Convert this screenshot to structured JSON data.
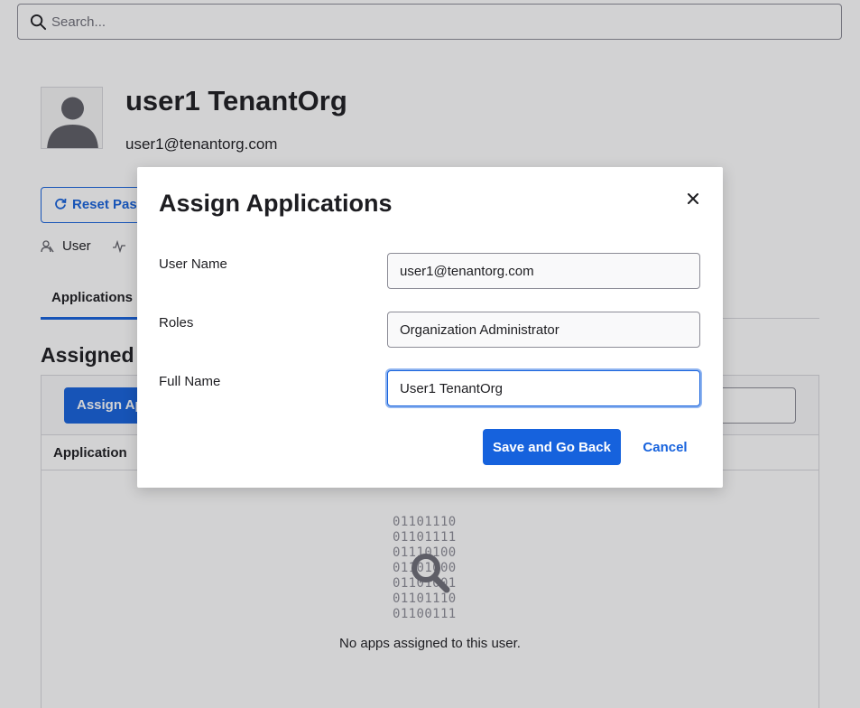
{
  "search": {
    "placeholder": "Search..."
  },
  "profile": {
    "name": "user1 TenantOrg",
    "email": "user1@tenantorg.com",
    "reset_label": "Reset Password",
    "role_label": "User"
  },
  "tabs": [
    {
      "label": "Applications"
    }
  ],
  "section": {
    "title": "Assigned Applications",
    "assign_label": "Assign Applications",
    "column_application": "Application",
    "binary_lines": [
      "01101110",
      "01101111",
      "01110100",
      "01101000",
      "01101001",
      "01101110",
      "01100111"
    ],
    "empty_message": "No apps assigned to this user."
  },
  "modal": {
    "title": "Assign Applications",
    "fields": [
      {
        "label": "User Name",
        "value": "user1@tenantorg.com"
      },
      {
        "label": "Roles",
        "value": "Organization Administrator"
      },
      {
        "label": "Full Name",
        "value": "User1 TenantOrg"
      }
    ],
    "save_label": "Save and Go Back",
    "cancel_label": "Cancel"
  },
  "colors": {
    "accent": "#1662dd",
    "text": "#1d1d21",
    "border": "#8c8c96",
    "focus_ring": "#8fb4f0"
  },
  "icons": {
    "search": "search-icon",
    "close": "close-icon",
    "reset": "refresh-icon",
    "user": "user-icon",
    "activity": "activity-icon",
    "empty": "magnifier-icon"
  }
}
